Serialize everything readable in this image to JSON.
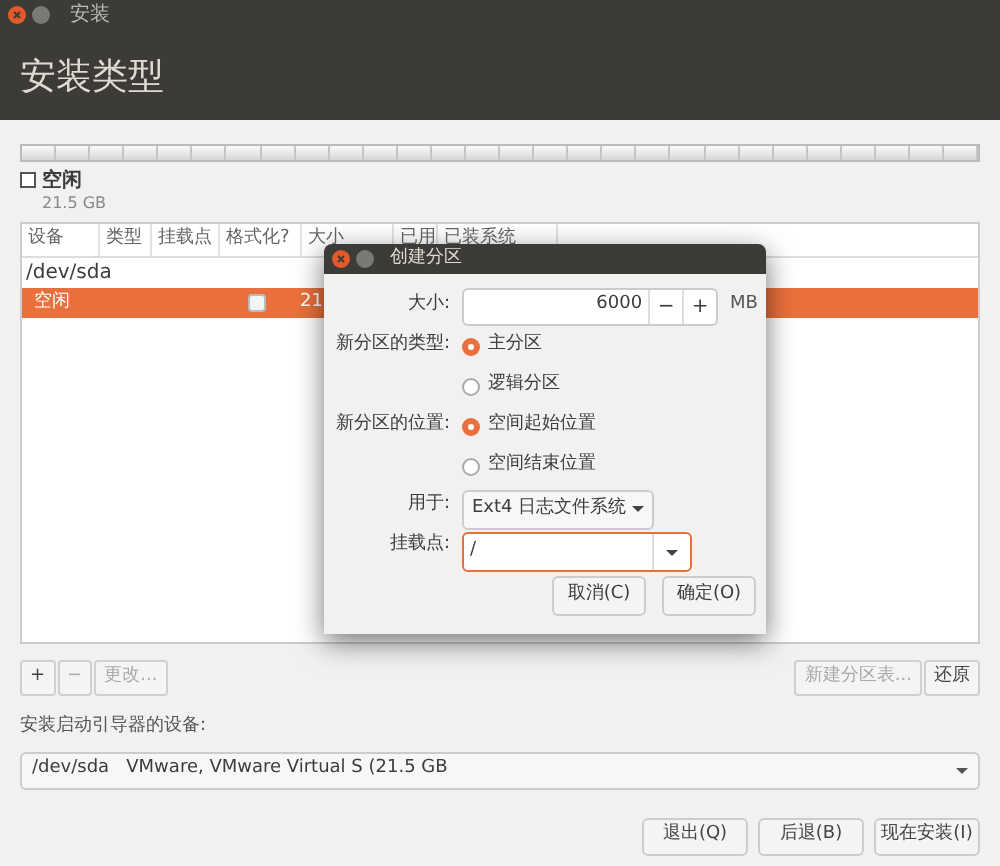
{
  "window": {
    "title": "安装"
  },
  "header": {
    "title": "安装类型"
  },
  "disk_legend": [
    {
      "label": "空闲",
      "size": "21.5 GB",
      "color": "#ffffff"
    }
  ],
  "table": {
    "columns": [
      "设备",
      "类型",
      "挂载点",
      "格式化?",
      "大小",
      "已用",
      "已装系统"
    ],
    "rows": [
      {
        "kind": "device",
        "device": "/dev/sda",
        "selected": false
      },
      {
        "kind": "partition",
        "device": "空闲",
        "format": false,
        "size": "21",
        "selected": true
      }
    ]
  },
  "partition_buttons": [
    {
      "label": "+",
      "disabled": false
    },
    {
      "label": "−",
      "disabled": true
    },
    {
      "label": "更改...",
      "disabled": true
    }
  ],
  "table_buttons": [
    {
      "label": "新建分区表...",
      "disabled": true
    },
    {
      "label": "还原",
      "disabled": false
    }
  ],
  "bootloader": {
    "label": "安装启动引导器的设备:",
    "value": "/dev/sda   VMware, VMware Virtual S (21.5 GB"
  },
  "buttons": [
    "退出(Q)",
    "后退(B)",
    "现在安装(I)"
  ],
  "dialog": {
    "title": "创建分区",
    "size": {
      "label": "大小:",
      "value": "6000",
      "minus": "−",
      "plus": "+",
      "unit": "MB"
    },
    "type": {
      "label": "新分区的类型:",
      "options": [
        {
          "label": "主分区",
          "selected": true
        },
        {
          "label": "逻辑分区",
          "selected": false
        }
      ]
    },
    "location": {
      "label": "新分区的位置:",
      "options": [
        {
          "label": "空间起始位置",
          "selected": true
        },
        {
          "label": "空间结束位置",
          "selected": false
        }
      ]
    },
    "use": {
      "label": "用于:",
      "value": "Ext4 日志文件系统"
    },
    "mount": {
      "label": "挂载点:",
      "value": "/"
    },
    "buttons": [
      "取消(C)",
      "确定(O)"
    ]
  }
}
